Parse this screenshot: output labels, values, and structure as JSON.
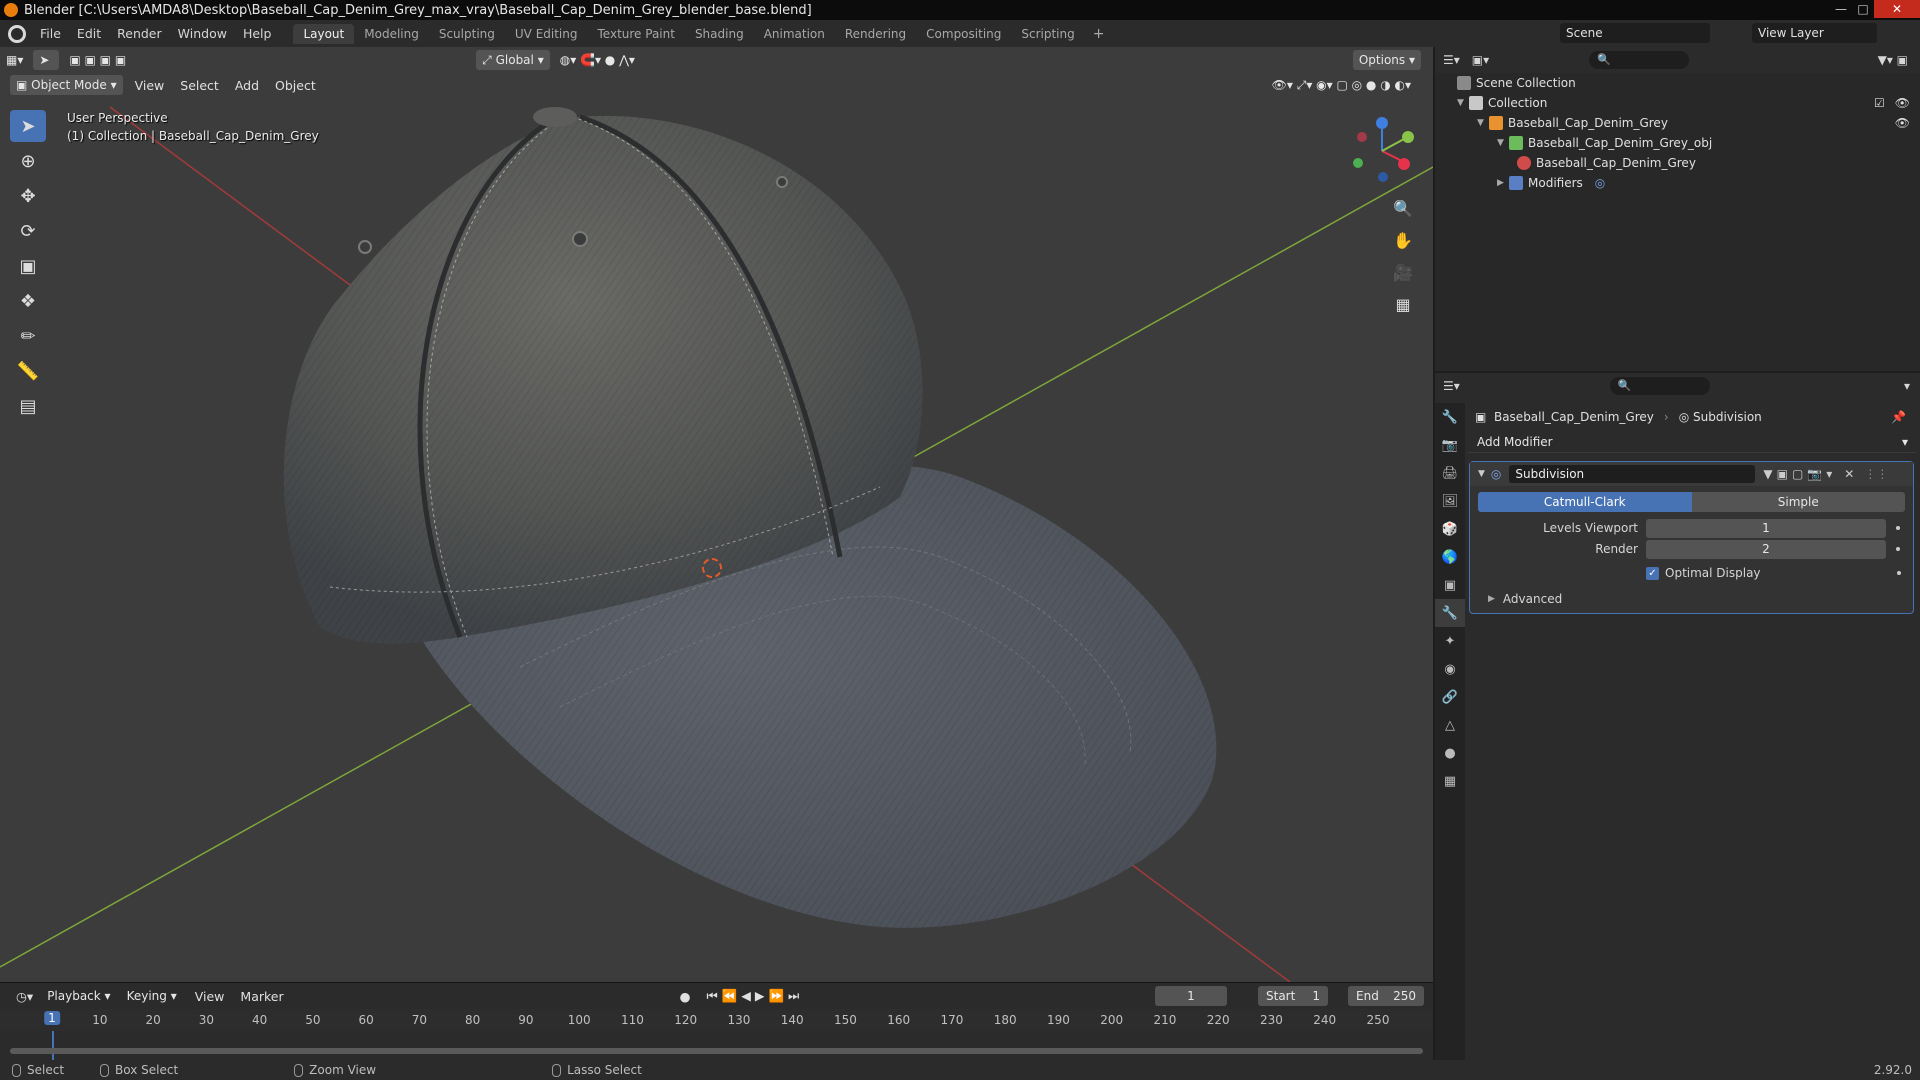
{
  "window": {
    "title": "Blender [C:\\Users\\AMDA8\\Desktop\\Baseball_Cap_Denim_Grey_max_vray\\Baseball_Cap_Denim_Grey_blender_base.blend]"
  },
  "menu": [
    "File",
    "Edit",
    "Render",
    "Window",
    "Help"
  ],
  "workspaces": [
    "Layout",
    "Modeling",
    "Sculpting",
    "UV Editing",
    "Texture Paint",
    "Shading",
    "Animation",
    "Rendering",
    "Compositing",
    "Scripting"
  ],
  "scene": {
    "name": "Scene",
    "view_layer": "View Layer"
  },
  "viewport": {
    "mode": "Object Mode",
    "menus": [
      "View",
      "Select",
      "Add",
      "Object"
    ],
    "transform_orientation": "Global",
    "options": "Options",
    "info_line1": "User Perspective",
    "info_line2": "(1) Collection | Baseball_Cap_Denim_Grey",
    "gizmo": {
      "z": "Z",
      "y": "Y",
      "x": "X"
    }
  },
  "outliner": {
    "scene_collection": "Scene Collection",
    "collection": "Collection",
    "object": "Baseball_Cap_Denim_Grey",
    "mesh": "Baseball_Cap_Denim_Grey_obj",
    "material": "Baseball_Cap_Denim_Grey",
    "modifiers": "Modifiers"
  },
  "properties": {
    "object_name": "Baseball_Cap_Denim_Grey",
    "modifier_crumb": "Subdivision",
    "add_modifier": "Add Modifier",
    "modifier": {
      "name": "Subdivision",
      "type_a": "Catmull-Clark",
      "type_b": "Simple",
      "levels_viewport_label": "Levels Viewport",
      "levels_viewport": "1",
      "render_label": "Render",
      "render": "2",
      "optimal_display": "Optimal Display",
      "advanced": "Advanced"
    }
  },
  "timeline": {
    "menus": [
      "Playback",
      "Keying",
      "View",
      "Marker"
    ],
    "current_frame": "1",
    "start_label": "Start",
    "start": "1",
    "end_label": "End",
    "end": "250",
    "ticks": [
      "1",
      "10",
      "20",
      "30",
      "40",
      "50",
      "60",
      "70",
      "80",
      "90",
      "100",
      "110",
      "120",
      "130",
      "140",
      "150",
      "160",
      "170",
      "180",
      "190",
      "200",
      "210",
      "220",
      "230",
      "240",
      "250"
    ]
  },
  "status": {
    "select": "Select",
    "box_select": "Box Select",
    "zoom_view": "Zoom View",
    "lasso_select": "Lasso Select",
    "version": "2.92.0"
  },
  "colors": {
    "accent": "#4772b3",
    "x_axis": "#e5334c",
    "y_axis": "#8bc34a",
    "z_axis": "#3f7fe0"
  }
}
